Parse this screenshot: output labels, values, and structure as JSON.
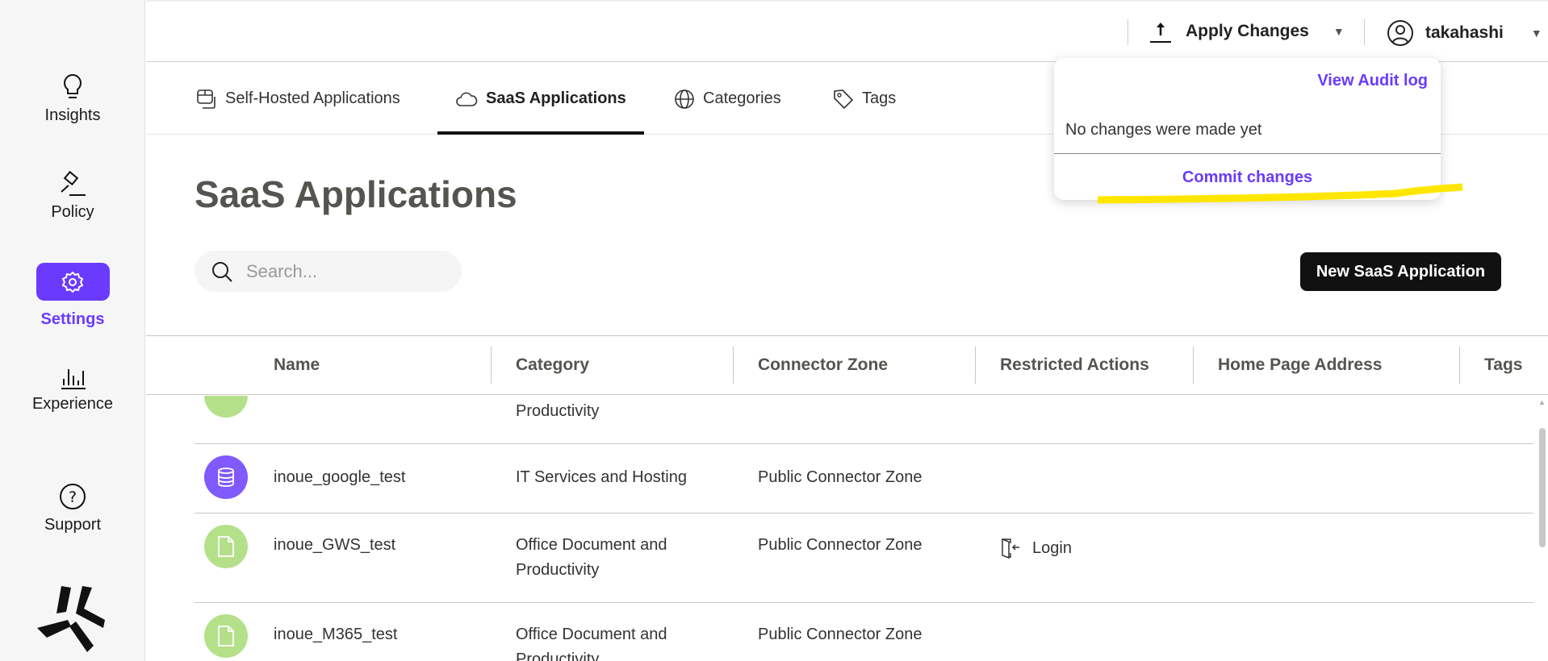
{
  "sidebar": {
    "items": [
      {
        "label": "Insights"
      },
      {
        "label": "Policy"
      },
      {
        "label": "Settings"
      },
      {
        "label": "Experience"
      },
      {
        "label": "Support"
      }
    ]
  },
  "header": {
    "apply_changes": "Apply Changes",
    "user": "takahashi"
  },
  "popup": {
    "audit_link": "View Audit log",
    "status": "No changes were made yet",
    "commit": "Commit changes"
  },
  "tabs": [
    {
      "label": "Self-Hosted Applications"
    },
    {
      "label": "SaaS Applications"
    },
    {
      "label": "Categories"
    },
    {
      "label": "Tags"
    }
  ],
  "page": {
    "title": "SaaS Applications",
    "search_placeholder": "Search...",
    "new_button": "New SaaS Application"
  },
  "table": {
    "columns": [
      "Name",
      "Category",
      "Connector Zone",
      "Restricted Actions",
      "Home Page Address",
      "Tags"
    ],
    "rows": [
      {
        "name": "",
        "category": "Productivity",
        "zone": "",
        "actions": "",
        "icon": "document-icon",
        "color": "#b5e08a"
      },
      {
        "name": "inoue_google_test",
        "category": "IT Services and Hosting",
        "zone": "Public Connector Zone",
        "actions": "",
        "icon": "database-icon",
        "color": "#8059ff"
      },
      {
        "name": "inoue_GWS_test",
        "category": "Office Document and",
        "category2": "Productivity",
        "zone": "Public Connector Zone",
        "actions": "Login",
        "icon": "document-icon",
        "color": "#b5e08a"
      },
      {
        "name": "inoue_M365_test",
        "category": "Office Document and",
        "category2": "Productivity",
        "zone": "Public Connector Zone",
        "actions": "",
        "icon": "document-icon",
        "color": "#b5e08a"
      }
    ]
  },
  "colors": {
    "accent": "#6a3bff",
    "highlight": "#ffe600"
  }
}
